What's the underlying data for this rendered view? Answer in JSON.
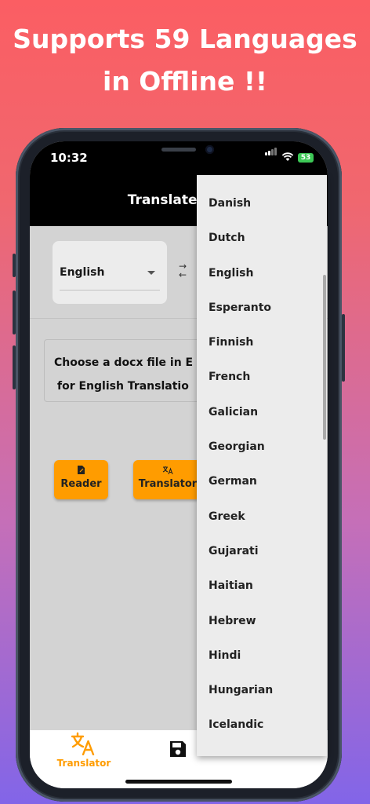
{
  "promo": {
    "line1": "Supports 59 Languages",
    "line2": "in Offline !!"
  },
  "status_bar": {
    "time": "10:32",
    "battery": "53"
  },
  "app_bar": {
    "title": "Translate Doc"
  },
  "language_selector": {
    "selected": "English"
  },
  "instructions": {
    "line1": "Choose a docx file in E",
    "line2": "for English Translatio"
  },
  "buttons": {
    "reader_label": "Reader",
    "translator_label": "Translator"
  },
  "bottom_nav": {
    "translator_label": "Translator"
  },
  "dropdown": {
    "options": [
      "Danish",
      "Dutch",
      "English",
      "Esperanto",
      "Finnish",
      "French",
      "Galician",
      "Georgian",
      "German",
      "Greek",
      "Gujarati",
      "Haitian",
      "Hebrew",
      "Hindi",
      "Hungarian",
      "Icelandic"
    ]
  },
  "colors": {
    "accent": "#ff9c00",
    "battery": "#3dc856"
  },
  "icons": {
    "reader": "document-edit-icon",
    "translator": "translate-icon",
    "save": "floppy-disk-icon",
    "swap": "swap-arrows-icon",
    "caret": "caret-down-icon"
  }
}
